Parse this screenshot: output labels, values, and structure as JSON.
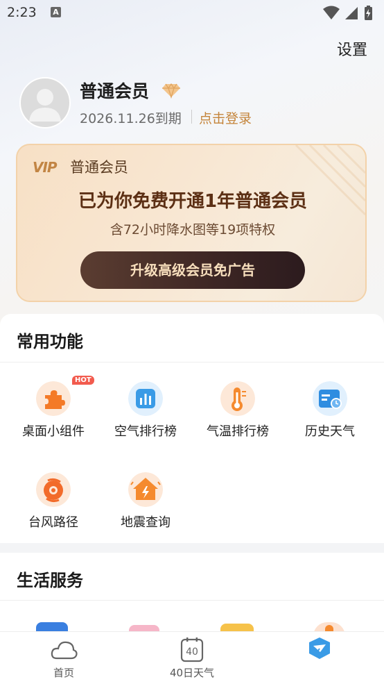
{
  "status": {
    "time": "2:23",
    "notification_glyph": "A"
  },
  "header": {
    "settings_label": "设置"
  },
  "profile": {
    "member_name": "普通会员",
    "expiry": "2026.11.26到期",
    "login_label": "点击登录"
  },
  "vip_card": {
    "logo_text": "VIP",
    "level": "普通会员",
    "headline": "已为你免费开通1年普通会员",
    "subtitle": "含72小时降水图等19项特权",
    "button_label": "升级高级会员免广告"
  },
  "common_functions": {
    "title": "常用功能",
    "hot_badge": "HOT",
    "items": [
      {
        "label": "桌面小组件",
        "icon": "puzzle-icon"
      },
      {
        "label": "空气排行榜",
        "icon": "air-ranking-icon"
      },
      {
        "label": "气温排行榜",
        "icon": "thermometer-icon"
      },
      {
        "label": "历史天气",
        "icon": "history-calendar-icon"
      },
      {
        "label": "台风路径",
        "icon": "typhoon-icon"
      },
      {
        "label": "地震查询",
        "icon": "earthquake-icon"
      }
    ]
  },
  "life_services": {
    "title": "生活服务"
  },
  "bottom_nav": {
    "items": [
      {
        "label": "首页",
        "icon": "cloud-icon"
      },
      {
        "label": "40日天气",
        "icon": "calendar-40-icon",
        "icon_text": "40"
      },
      {
        "label": "",
        "icon": "profile-active-icon"
      }
    ]
  },
  "colors": {
    "accent_gold": "#c4843a",
    "vip_button_bg": "#3d2624",
    "hot_red": "#f25b4e",
    "active_tab_blue": "#3a9be6"
  }
}
